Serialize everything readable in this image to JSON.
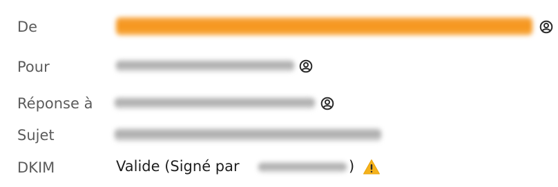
{
  "header_fields": {
    "from_label": "De",
    "to_label": "Pour",
    "reply_to_label": "Réponse à",
    "subject_label": "Sujet",
    "dkim_label": "DKIM"
  },
  "dkim": {
    "status_text": "Valide (Signé par",
    "closing_paren": ")",
    "warning_icon": "warning-triangle-icon",
    "warning_color": "#f5b21b"
  },
  "icons": {
    "contact_icon": "contact-icon"
  },
  "colors": {
    "redaction_highlight": "#f59419",
    "redaction_grey": "#a8a8a8"
  }
}
